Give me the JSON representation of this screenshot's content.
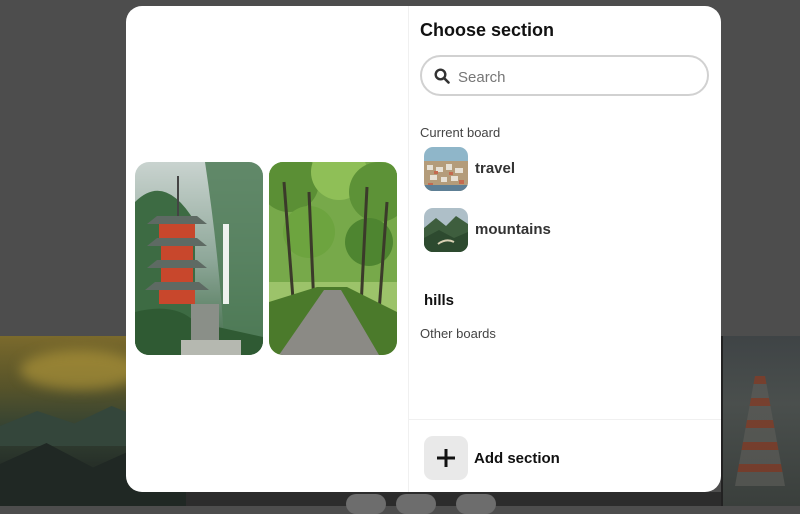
{
  "modal": {
    "title": "Choose section",
    "search": {
      "placeholder": "Search",
      "value": ""
    },
    "current_board": {
      "label": "Current board",
      "sections": [
        {
          "name": "travel",
          "icon": "board-thumbnail-travel"
        },
        {
          "name": "mountains",
          "icon": "board-thumbnail-mountains"
        },
        {
          "name": "hills"
        }
      ]
    },
    "other_boards": {
      "label": "Other boards"
    },
    "footer": {
      "add_label": "Add section",
      "icon": "plus-icon"
    }
  },
  "preview": {
    "images": [
      {
        "subject": "pagoda-waterfall"
      },
      {
        "subject": "forest-road"
      }
    ]
  }
}
